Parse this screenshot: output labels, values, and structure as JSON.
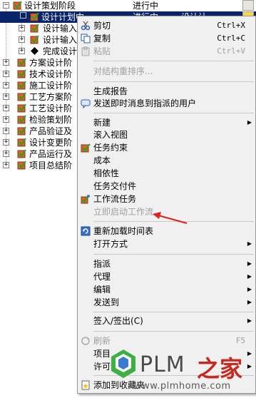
{
  "tree": {
    "rows": [
      {
        "label": "设计策划阶段",
        "status": "进行中",
        "col3": "",
        "expander": "−",
        "icon": "check-task-icon"
      },
      {
        "label": "设计计划中",
        "status": "进行中",
        "col3": "设计计",
        "expander": "",
        "icon": "check-task-icon"
      },
      {
        "label": "设计输入",
        "status": "",
        "col3": "",
        "expander": "+",
        "icon": "check-task-icon"
      },
      {
        "label": "设计输入",
        "status": "",
        "col3": "",
        "expander": "+",
        "icon": "check-task-icon"
      },
      {
        "label": "完成设计",
        "status": "",
        "col3": "",
        "expander": "+",
        "icon": "diamond-icon"
      },
      {
        "label": "方案设计阶",
        "status": "",
        "col3": "",
        "expander": "+",
        "icon": "check-task-icon"
      },
      {
        "label": "技术设计阶",
        "status": "",
        "col3": "",
        "expander": "+",
        "icon": "check-task-icon"
      },
      {
        "label": "施工设计阶",
        "status": "",
        "col3": "",
        "expander": "+",
        "icon": "check-task-icon"
      },
      {
        "label": "工艺方案阶",
        "status": "",
        "col3": "",
        "expander": "+",
        "icon": "check-task-icon"
      },
      {
        "label": "工艺设计阶",
        "status": "",
        "col3": "",
        "expander": "+",
        "icon": "check-task-icon"
      },
      {
        "label": "检验策划阶",
        "status": "",
        "col3": "",
        "expander": "+",
        "icon": "check-task-icon"
      },
      {
        "label": "产品验证及",
        "status": "",
        "col3": "",
        "expander": "+",
        "icon": "check-task-icon"
      },
      {
        "label": "设计变更阶",
        "status": "",
        "col3": "",
        "expander": "+",
        "icon": "check-task-icon"
      },
      {
        "label": "产品运行及",
        "status": "",
        "col3": "",
        "expander": "+",
        "icon": "check-task-icon"
      },
      {
        "label": "项目总结阶",
        "status": "",
        "col3": "",
        "expander": "+",
        "icon": "check-task-icon"
      }
    ]
  },
  "menu": {
    "cut": {
      "label": "剪切",
      "shortcut": "Ctrl+X",
      "icon": "scissors-icon"
    },
    "copy": {
      "label": "复制",
      "shortcut": "Ctrl+C",
      "icon": "copy-icon"
    },
    "paste": {
      "label": "粘贴",
      "shortcut": "Ctrl+V",
      "icon": "paste-icon"
    },
    "reorder": {
      "label": "对结构重排序..."
    },
    "gen_report": {
      "label": "生成报告"
    },
    "send_im": {
      "label": "发送即时消息到指派的用户",
      "icon": "chat-icon"
    },
    "new": {
      "label": "新建"
    },
    "insert_view": {
      "label": "滚入视图"
    },
    "task_constraint": {
      "label": "任务约束",
      "icon": "task-constraint-icon"
    },
    "cost": {
      "label": "成本"
    },
    "dependency": {
      "label": "相依性"
    },
    "deliverables": {
      "label": "任务交付件"
    },
    "workflow_task": {
      "label": "工作流任务",
      "icon": "workflow-icon"
    },
    "start_workflow": {
      "label": "立即启动工作流"
    },
    "reload_schedule": {
      "label": "重新加载时间表",
      "icon": "reload-icon"
    },
    "open_mode": {
      "label": "打开方式"
    },
    "assign": {
      "label": "指派"
    },
    "proxy": {
      "label": "代理"
    },
    "edit": {
      "label": "编辑"
    },
    "send_to": {
      "label": "发送到"
    },
    "checkin_out": {
      "label": "签入/签出(C)"
    },
    "refresh": {
      "label": "刷新",
      "shortcut": "F5",
      "icon": "refresh-icon"
    },
    "project": {
      "label": "项目"
    },
    "permission": {
      "label": "许可证(I"
    },
    "add_favorite": {
      "label": "添加到收藏夹",
      "icon": "favorite-icon"
    }
  },
  "watermark": {
    "brand": "PLM",
    "brand_cn": "之家",
    "url": "www.plmhome.com"
  },
  "colors": {
    "selection": "#0a246a",
    "menu_bg": "#f0f0f0",
    "disabled": "#a0a0a0",
    "arrow_red": "#e02020",
    "watermark_red": "#c8281e"
  }
}
